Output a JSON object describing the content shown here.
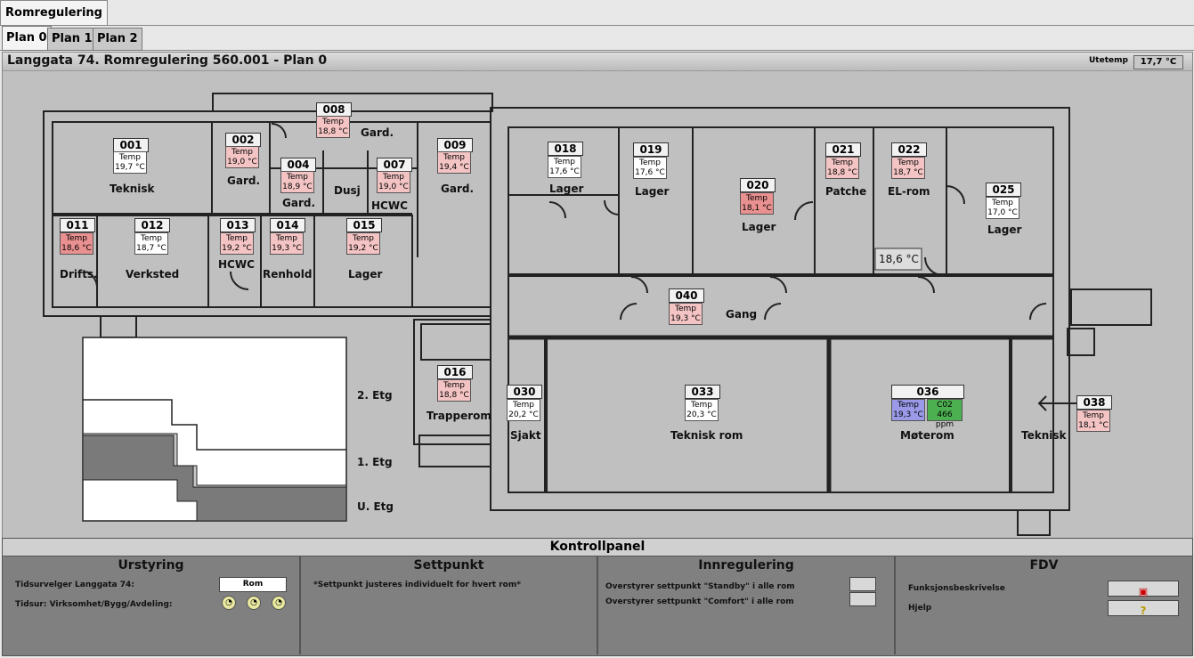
{
  "app_tab": "Romregulering",
  "plan_tabs": [
    "Plan 0",
    "Plan 1",
    "Plan 2"
  ],
  "page_title": "Langgata 74. Romregulering 560.001 - Plan 0",
  "ute": {
    "label": "Utetemp",
    "value": "17,7 °C"
  },
  "rooms": {
    "r001": {
      "num": "001",
      "temp": "Temp",
      "val": "19,7 °C",
      "name": "Teknisk"
    },
    "r002": {
      "num": "002",
      "temp": "Temp",
      "val": "19,0 °C",
      "name": "Gard."
    },
    "r008": {
      "num": "008",
      "temp": "Temp",
      "val": "18,8 °C",
      "name": "Gard."
    },
    "r004": {
      "num": "004",
      "temp": "Temp",
      "val": "18,9 °C",
      "name": "Gard."
    },
    "r007": {
      "num": "007",
      "temp": "Temp",
      "val": "19,0 °C",
      "name": "HCWC"
    },
    "dusj": {
      "name": "Dusj"
    },
    "r009": {
      "num": "009",
      "temp": "Temp",
      "val": "19,4 °C",
      "name": "Gard."
    },
    "r011": {
      "num": "011",
      "temp": "Temp",
      "val": "18,6 °C",
      "name": "Drifts."
    },
    "r012": {
      "num": "012",
      "temp": "Temp",
      "val": "18,7 °C",
      "name": "Verksted"
    },
    "r013": {
      "num": "013",
      "temp": "Temp",
      "val": "19,2 °C",
      "name": "HCWC"
    },
    "r014": {
      "num": "014",
      "temp": "Temp",
      "val": "19,3 °C",
      "name": "Renhold"
    },
    "r015": {
      "num": "015",
      "temp": "Temp",
      "val": "19,2 °C",
      "name": "Lager"
    },
    "r016": {
      "num": "016",
      "temp": "Temp",
      "val": "18,8 °C",
      "name": "Trapperom"
    },
    "r018": {
      "num": "018",
      "temp": "Temp",
      "val": "17,6 °C",
      "name": "Lager"
    },
    "r019": {
      "num": "019",
      "temp": "Temp",
      "val": "17,6 °C",
      "name": "Lager"
    },
    "r020": {
      "num": "020",
      "temp": "Temp",
      "val": "18,1 °C",
      "name": "Lager"
    },
    "r021": {
      "num": "021",
      "temp": "Temp",
      "val": "18,8 °C",
      "name": "Patche"
    },
    "r022": {
      "num": "022",
      "temp": "Temp",
      "val": "18,7 °C",
      "name": "EL-rom",
      "extra": "18,6 °C"
    },
    "r025": {
      "num": "025",
      "temp": "Temp",
      "val": "17,0 °C",
      "name": "Lager"
    },
    "r040": {
      "num": "040",
      "temp": "Temp",
      "val": "19,3 °C",
      "name": "Gang"
    },
    "r030": {
      "num": "030",
      "temp": "Temp",
      "val": "20,2 °C",
      "name": "Sjakt"
    },
    "r033": {
      "num": "033",
      "temp": "Temp",
      "val": "20,3 °C",
      "name": "Teknisk rom"
    },
    "r036": {
      "num": "036",
      "temp": "Temp",
      "val": "19,3 °C",
      "co2": "C02",
      "co2val": "466 ppm",
      "name": "Møterom"
    },
    "r038": {
      "num": "038",
      "temp": "Temp",
      "val": "18,1 °C",
      "name": "Teknisk"
    }
  },
  "floors": [
    "2. Etg",
    "1. Etg",
    "U. Etg"
  ],
  "panel": {
    "title": "Kontrollpanel",
    "urstyring": {
      "title": "Urstyring",
      "line1": "Tidsurvelger Langgata 74:",
      "rom_btn": "Rom",
      "line2": "Tidsur: Virksomhet/Bygg/Avdeling:"
    },
    "settpunkt": {
      "title": "Settpunkt",
      "note": "*Settpunkt justeres individuelt for hvert rom*"
    },
    "innregulering": {
      "title": "Innregulering",
      "line1": "Overstyrer settpunkt \"Standby\" i alle rom",
      "line2": "Overstyrer settpunkt \"Comfort\" i alle rom"
    },
    "fdv": {
      "title": "FDV",
      "line1": "Funksjonsbeskrivelse",
      "line2": "Hjelp"
    }
  }
}
